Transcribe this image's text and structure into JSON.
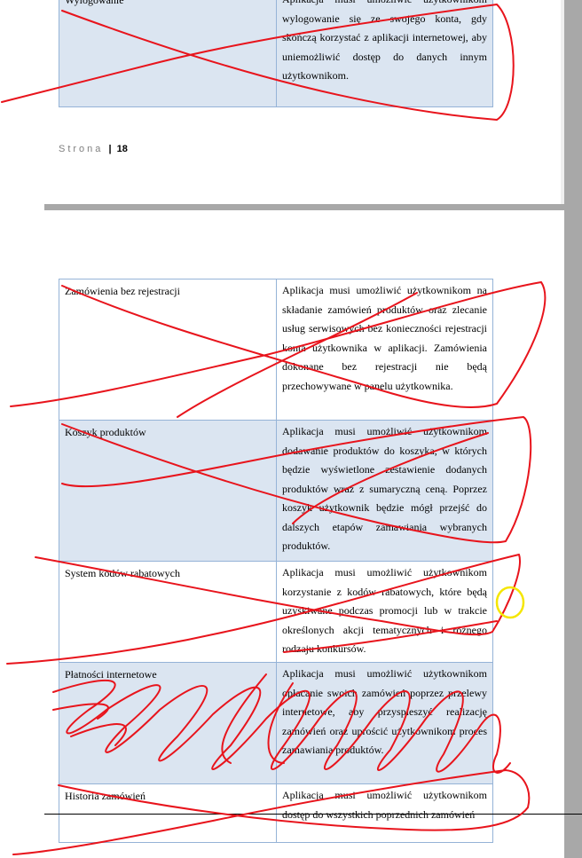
{
  "page1": {
    "rows": [
      {
        "name": "Wylogowanie",
        "description": "Aplikacja musi umożliwić użytkownikom wylogowanie się ze swojego konta, gdy skończą korzystać z aplikacji internetowej, aby uniemożliwić dostęp do danych innym użytkownikom."
      }
    ],
    "footer": {
      "label": "Strona",
      "separator": "|",
      "page_number": "18"
    }
  },
  "page2": {
    "rows": [
      {
        "name": "Zamówienia bez rejestracji",
        "description": "Aplikacja musi umożliwić użytkownikom na składanie zamówień produktów oraz zlecanie usług serwisowych bez konieczności rejestracji konta użytkownika w aplikacji. Zamówienia dokonane bez rejestracji nie będą przechowywane w panelu użytkownika."
      },
      {
        "name": "Koszyk produktów",
        "description": "Aplikacja musi umożliwić użytkownikom dodawanie produktów do koszyka, w których będzie wyświetlone zestawienie dodanych produktów wraz z sumaryczną ceną. Poprzez koszyk użytkownik będzie mógł przejść do dalszych etapów zamawiania wybranych produktów."
      },
      {
        "name": "System kodów rabatowych",
        "description": "Aplikacja musi umożliwić użytkownikom korzystanie z kodów rabatowych, które będą uzyskiwane podczas promocji lub w trakcie określonych akcji tematycznych i różnego rodzaju konkursów."
      },
      {
        "name": "Płatności internetowe",
        "description": "Aplikacja musi umożliwić użytkownikom opłacanie swoich zamówień poprzez przelewy internetowe, aby przyspieszyć realizację zamówień oraz uprościć użytkownikom proces zamawiania produktów."
      },
      {
        "name": "Historia zamówień",
        "description": "Aplikacja musi umożliwić użytkownikom dostęp do wszystkich poprzednich zamówień"
      }
    ]
  },
  "annotation_colors": {
    "strike": "#e8141c",
    "highlight": "#f5e600"
  }
}
